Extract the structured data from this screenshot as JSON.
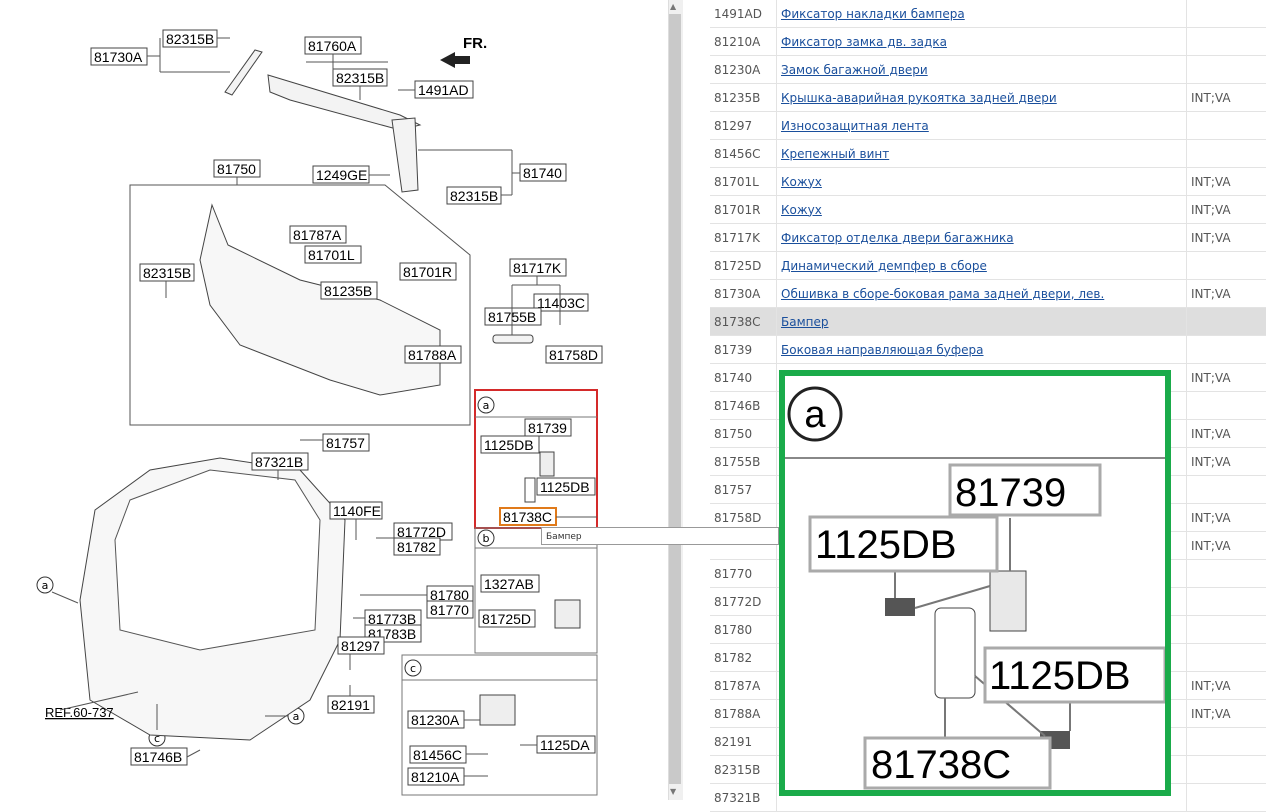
{
  "diagram": {
    "fr_label": "FR.",
    "ref_label": "REF.60-737",
    "section_labels": {
      "a": "a",
      "b": "b",
      "c": "c"
    },
    "labels": [
      "82315B",
      "81730A",
      "81760A",
      "82315B",
      "1491AD",
      "1249GE",
      "81740",
      "82315B",
      "81750",
      "81787A",
      "81701L",
      "82315B",
      "81701R",
      "81235B",
      "81717K",
      "11403C",
      "81755B",
      "81758D",
      "81788A",
      "81757",
      "81739",
      "1125DB",
      "1125DB",
      "81738C",
      "87321B",
      "1140FE",
      "81772D",
      "81782",
      "1327AB",
      "81725D",
      "81780",
      "81770",
      "81773B",
      "81783B",
      "81297",
      "82191",
      "81230A",
      "81456C",
      "1125DA",
      "81210A",
      "81746B"
    ]
  },
  "tooltip": "Бампер",
  "zoom": {
    "section": "a",
    "labels": [
      "81739",
      "1125DB",
      "1125DB",
      "81738C"
    ]
  },
  "parts": [
    {
      "code": "1491AD",
      "name": "Фиксатор накладки бампера",
      "mod": ""
    },
    {
      "code": "81210A",
      "name": "Фиксатор замка дв. задка",
      "mod": ""
    },
    {
      "code": "81230A",
      "name": "Замок багажной двери",
      "mod": ""
    },
    {
      "code": "81235B",
      "name": "Крышка-аварийная рукоятка задней двери",
      "mod": "INT;VA"
    },
    {
      "code": "81297",
      "name": "Износозащитная лента",
      "mod": ""
    },
    {
      "code": "81456C",
      "name": "Крепежный винт",
      "mod": ""
    },
    {
      "code": "81701L",
      "name": "Кожух",
      "mod": "INT;VA"
    },
    {
      "code": "81701R",
      "name": "Кожух",
      "mod": "INT;VA"
    },
    {
      "code": "81717K",
      "name": "Фиксатор отделка двери багажника",
      "mod": "INT;VA"
    },
    {
      "code": "81725D",
      "name": "Динамический демпфер в сборе",
      "mod": ""
    },
    {
      "code": "81730A",
      "name": "Обшивка в сборе-боковая рама задней двери, лев.",
      "mod": "INT;VA"
    },
    {
      "code": "81738C",
      "name": "Бампер",
      "mod": "",
      "selected": true
    },
    {
      "code": "81739",
      "name": "Боковая направляющая буфера",
      "mod": ""
    },
    {
      "code": "81740",
      "name": "",
      "mod": "INT;VA"
    },
    {
      "code": "81746B",
      "name": "",
      "mod": ""
    },
    {
      "code": "81750",
      "name": "",
      "mod": "INT;VA"
    },
    {
      "code": "81755B",
      "name": "",
      "mod": "INT;VA"
    },
    {
      "code": "81757",
      "name": "",
      "mod": ""
    },
    {
      "code": "81758D",
      "name": "",
      "mod": "INT;VA"
    },
    {
      "code": "",
      "name": "",
      "mod": "INT;VA"
    },
    {
      "code": "81770",
      "name": "",
      "mod": ""
    },
    {
      "code": "81772D",
      "name": "",
      "mod": ""
    },
    {
      "code": "81780",
      "name": "",
      "mod": ""
    },
    {
      "code": "81782",
      "name": "",
      "mod": ""
    },
    {
      "code": "81787A",
      "name": "",
      "mod": "INT;VA"
    },
    {
      "code": "81788A",
      "name": "",
      "mod": "INT;VA"
    },
    {
      "code": "82191",
      "name": "",
      "mod": ""
    },
    {
      "code": "82315B",
      "name": "",
      "mod": ""
    },
    {
      "code": "87321B",
      "name": "",
      "mod": ""
    }
  ],
  "colors": {
    "highlight_box": "#d42a2a",
    "selected_label": "#e07a1a",
    "zoom_border": "#1aab4a",
    "link": "#1a4f9c"
  }
}
